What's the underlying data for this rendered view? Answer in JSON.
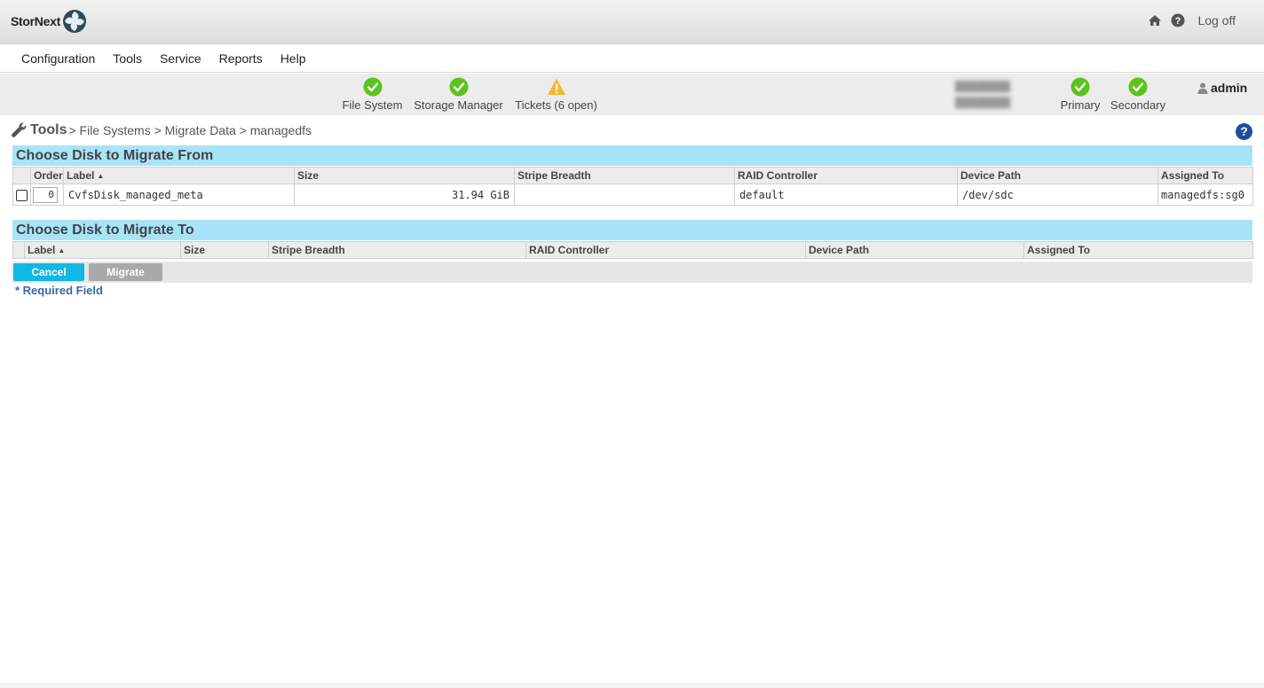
{
  "app": {
    "logo_text": "StorNext",
    "logoff_label": "Log off"
  },
  "menu": {
    "items": [
      "Configuration",
      "Tools",
      "Service",
      "Reports",
      "Help"
    ]
  },
  "status": {
    "file_system": "File System",
    "storage_manager": "Storage Manager",
    "tickets": "Tickets (6 open)",
    "primary": "Primary",
    "secondary": "Secondary",
    "user": "admin",
    "ok_color": "#5cc21c",
    "warn_color": "#f7b731"
  },
  "breadcrumb": {
    "root": "Tools",
    "path": "> File Systems > Migrate Data > managedfs"
  },
  "from_section": {
    "title": "Choose Disk to Migrate From",
    "headers": {
      "order": "Order",
      "label": "Label",
      "size": "Size",
      "stripe": "Stripe Breadth",
      "raid": "RAID Controller",
      "device": "Device Path",
      "assigned": "Assigned To"
    },
    "rows": [
      {
        "order": "0",
        "label": "CvfsDisk_managed_meta",
        "size": "31.94 GiB",
        "stripe": "",
        "raid": "default",
        "device": "/dev/sdc",
        "assigned": "managedfs:sg0"
      }
    ]
  },
  "to_section": {
    "title": "Choose Disk to Migrate To",
    "headers": {
      "label": "Label",
      "size": "Size",
      "stripe": "Stripe Breadth",
      "raid": "RAID Controller",
      "device": "Device Path",
      "assigned": "Assigned To"
    }
  },
  "buttons": {
    "cancel": "Cancel",
    "migrate": "Migrate"
  },
  "required_note": "* Required Field",
  "colors": {
    "section_header": "#a8e4f8",
    "cancel_button": "#11b8e6",
    "migrate_button": "#a9a9a9",
    "help_icon": "#1f4e9b"
  }
}
